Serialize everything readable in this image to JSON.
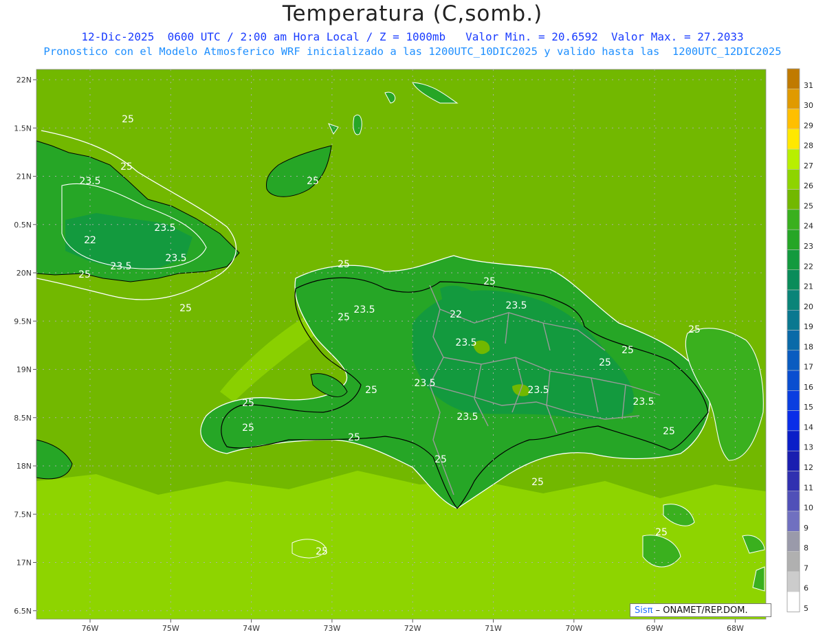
{
  "header": {
    "title": "Temperatura (C,somb.)",
    "line1": "12-Dic-2025  0600 UTC / 2:00 am Hora Local / Z = 1000mb   Valor Min. = 20.6592  Valor Max. = 27.2033",
    "line2": "Pronostico con el Modelo Atmosferico WRF inicializado a las 1200UTC_10DIC2025 y valido hasta las  1200UTC_12DIC2025"
  },
  "map": {
    "lat_labels": [
      "22N",
      "1.5N",
      "21N",
      "0.5N",
      "20N",
      "9.5N",
      "19N",
      "8.5N",
      "18N",
      "7.5N",
      "17N",
      "6.5N"
    ],
    "lon_labels": [
      "76W",
      "75W",
      "74W",
      "73W",
      "72W",
      "71W",
      "70W",
      "69W",
      "68W"
    ],
    "contour_labels": [
      "25",
      "25",
      "23.5",
      "23.5",
      "22",
      "23.5",
      "23.5",
      "25",
      "25",
      "25",
      "25",
      "23.5",
      "25",
      "22",
      "23.5",
      "23.5",
      "25",
      "23.5",
      "23.5",
      "25",
      "23.5",
      "25",
      "25",
      "23.5",
      "25",
      "25",
      "25",
      "25",
      "25",
      "25"
    ],
    "colors": {
      "sea": "#72b800",
      "sea_warm": "#8ed400",
      "land_23": "#26a626",
      "land_22": "#139a3e",
      "land_24": "#3ab01e",
      "border": "#9a9a9a",
      "coast": "#000000",
      "contour": "#ffffff"
    }
  },
  "colorbar": {
    "levels": [
      "31",
      "30",
      "29",
      "28",
      "27",
      "26",
      "25",
      "24",
      "23",
      "22",
      "21",
      "20",
      "19",
      "18",
      "17",
      "16",
      "15",
      "14",
      "13",
      "12",
      "11",
      "10",
      "9",
      "8",
      "7",
      "6",
      "5"
    ],
    "colors": [
      "#c07a00",
      "#e09a00",
      "#ffbf00",
      "#ffe800",
      "#b8ef00",
      "#8ed400",
      "#72b800",
      "#3ab01e",
      "#26a626",
      "#139a3e",
      "#0a8c5a",
      "#0a8478",
      "#0a7890",
      "#0a6aa8",
      "#0a5cc0",
      "#0a4ed0",
      "#0a3ee0",
      "#0a2ee8",
      "#0a1ec8",
      "#1a1eb0",
      "#3030b0",
      "#5050b8",
      "#7070c0",
      "#9a9aaa",
      "#b0b0b0",
      "#cccccc",
      "#ffffff"
    ]
  },
  "credit": {
    "brand": "Sisπ",
    "text": " – ONAMET/REP.DOM."
  }
}
